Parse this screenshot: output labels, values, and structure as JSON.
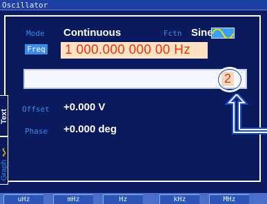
{
  "window": {
    "title": "Oscillator"
  },
  "side_tabs": {
    "text_label": "Text",
    "graph_label": "Graph"
  },
  "fields": {
    "mode": {
      "label": "Mode",
      "value": "Continuous"
    },
    "fctn": {
      "label": "Fctn",
      "value": "Sine",
      "icon": "sine-wave-icon"
    },
    "freq": {
      "label": "Freq",
      "value": "1 000.000 000 00 Hz"
    },
    "input": {
      "value": "2"
    },
    "offset": {
      "label": "Offset",
      "value": "+0.000 V"
    },
    "phase": {
      "label": "Phase",
      "value": "+0.000 deg"
    }
  },
  "softkeys": [
    "uHz",
    "mHz",
    "Hz",
    "kHz",
    "MHz"
  ],
  "colors": {
    "background": "#0b1c63",
    "label_blue": "#3a8ce8",
    "freq_highlight_bg": "#ffe1c3",
    "freq_text": "#ef3510"
  }
}
